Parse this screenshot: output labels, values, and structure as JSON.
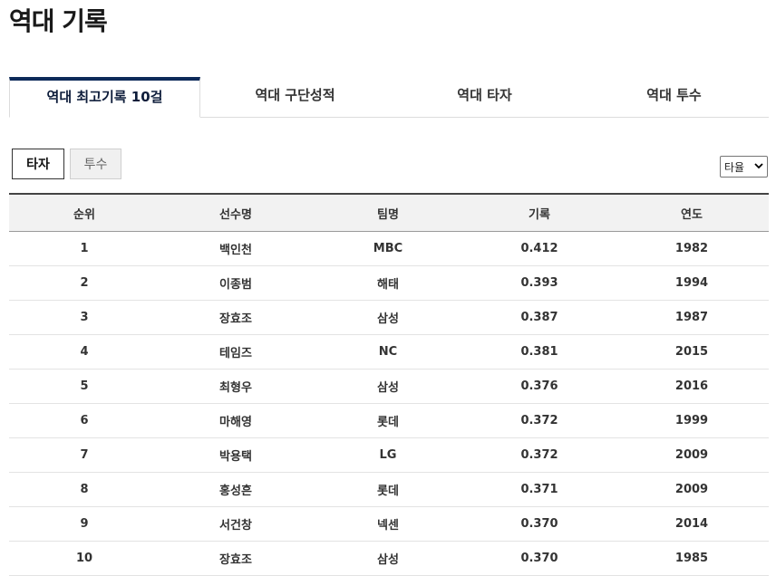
{
  "page": {
    "title": "역대 기록"
  },
  "tabs": [
    {
      "label": "역대 최고기록 10걸",
      "active": true
    },
    {
      "label": "역대 구단성적",
      "active": false
    },
    {
      "label": "역대 타자",
      "active": false
    },
    {
      "label": "역대 투수",
      "active": false
    }
  ],
  "type_buttons": [
    {
      "label": "타자",
      "active": true
    },
    {
      "label": "투수",
      "active": false
    }
  ],
  "stat_select": {
    "selected": "타율"
  },
  "table": {
    "headers": [
      "순위",
      "선수명",
      "팀명",
      "기록",
      "연도"
    ],
    "rows": [
      [
        "1",
        "백인천",
        "MBC",
        "0.412",
        "1982"
      ],
      [
        "2",
        "이종범",
        "해태",
        "0.393",
        "1994"
      ],
      [
        "3",
        "장효조",
        "삼성",
        "0.387",
        "1987"
      ],
      [
        "4",
        "테임즈",
        "NC",
        "0.381",
        "2015"
      ],
      [
        "5",
        "최형우",
        "삼성",
        "0.376",
        "2016"
      ],
      [
        "6",
        "마해영",
        "롯데",
        "0.372",
        "1999"
      ],
      [
        "7",
        "박용택",
        "LG",
        "0.372",
        "2009"
      ],
      [
        "8",
        "홍성흔",
        "롯데",
        "0.371",
        "2009"
      ],
      [
        "9",
        "서건창",
        "넥센",
        "0.370",
        "2014"
      ],
      [
        "10",
        "장효조",
        "삼성",
        "0.370",
        "1985"
      ]
    ]
  }
}
